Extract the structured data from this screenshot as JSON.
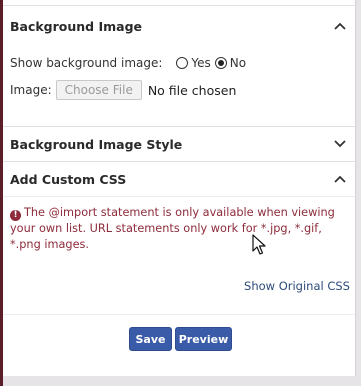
{
  "background_image": {
    "title": "Background Image",
    "show_label": "Show background image:",
    "option_yes": "Yes",
    "option_no": "No",
    "selected": "No",
    "image_label": "Image:",
    "choose_file_label": "Choose File",
    "no_file_text": "No file chosen"
  },
  "background_image_style": {
    "title": "Background Image Style"
  },
  "custom_css": {
    "title": "Add Custom CSS",
    "warning_line1": "The @import statement is only available when viewing",
    "warning_line2": "your own list. URL statements only work for *.jpg, *.gif,",
    "warning_line3": "*.png images.",
    "show_original_label": "Show Original CSS"
  },
  "actions": {
    "save_label": "Save",
    "preview_label": "Preview"
  },
  "colors": {
    "accent_button": "#3a5ba8",
    "warning_text": "#8d2b3a",
    "link": "#2c4a7a"
  }
}
